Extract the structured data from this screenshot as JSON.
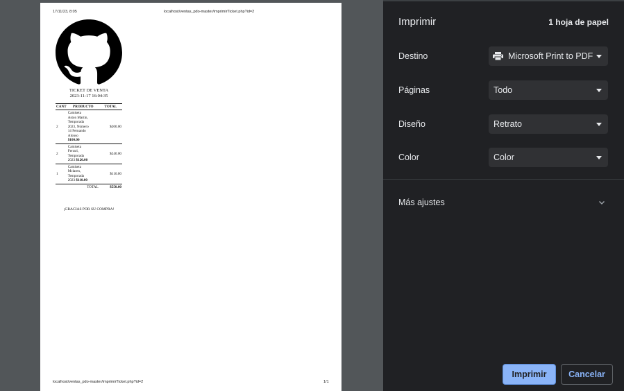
{
  "preview": {
    "header": {
      "datetime": "17/11/23, 8:05",
      "url": "localhost/ventas_pdo-master/imprimirTicket.php?id=2"
    },
    "footer": {
      "url": "localhost/ventas_pdo-master/imprimirTicket.php?id=2",
      "page": "1/1"
    },
    "ticket": {
      "title": "TICKET DE VENTA",
      "date": "2023-11-17 16:04:35",
      "columns": [
        "CANT",
        "PRODUCTO",
        "TOTAL"
      ],
      "rows": [
        {
          "cant": "2",
          "producto_lines": [
            "Camiseta",
            "Aston Martin,",
            "Temporada",
            "2023, Número",
            "14 Fernando",
            "Alonso"
          ],
          "unit_price": "$100.00",
          "total": "$200.00"
        },
        {
          "cant": "2",
          "producto_lines": [
            "Camiseta",
            "Ferrari,",
            "Temporada",
            "2023"
          ],
          "unit_price": "$120.00",
          "total": "$240.00"
        },
        {
          "cant": "1",
          "producto_lines": [
            "Camiseta",
            "Mclaren,",
            "Temporada",
            "2023"
          ],
          "unit_price": "$110.00",
          "total": "$110.00"
        }
      ],
      "total_label": "TOTAL",
      "total_value": "$550.00",
      "thanks": "¡GRACIAS POR SU COMPRA!"
    }
  },
  "panel": {
    "title": "Imprimir",
    "sheets": "1 hoja de papel",
    "destino": {
      "label": "Destino",
      "value": "Microsoft Print to PDF",
      "icon": "printer-icon"
    },
    "paginas": {
      "label": "Páginas",
      "value": "Todo"
    },
    "diseno": {
      "label": "Diseño",
      "value": "Retrato"
    },
    "color": {
      "label": "Color",
      "value": "Color"
    },
    "more_settings": "Más ajustes",
    "print_button": "Imprimir",
    "cancel_button": "Cancelar"
  },
  "colors": {
    "panel_bg": "#202124",
    "accent": "#8ab4f8",
    "preview_bg": "#525659"
  }
}
